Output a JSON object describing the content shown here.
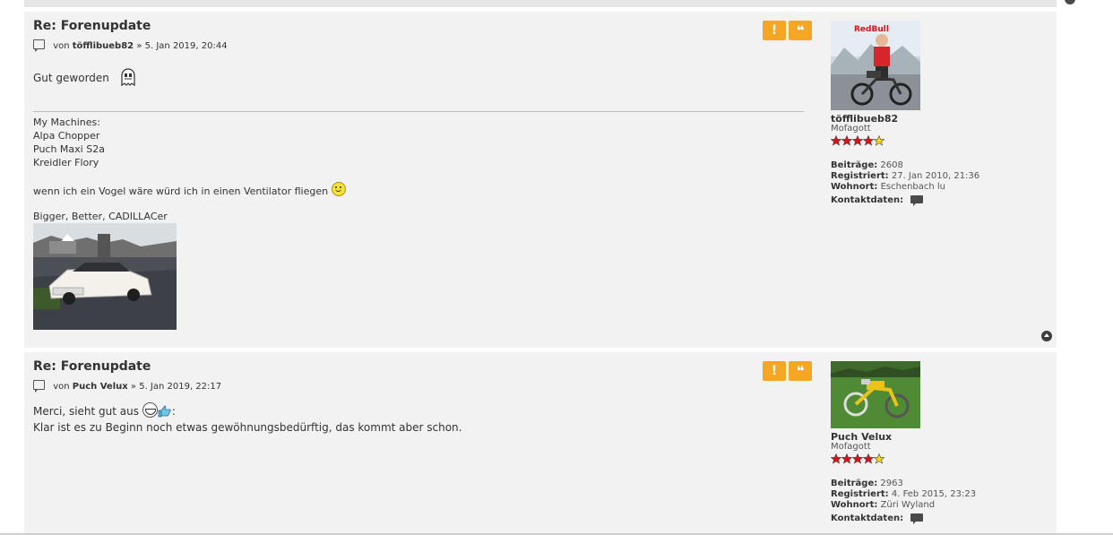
{
  "posts": [
    {
      "title": "Re: Forenupdate",
      "meta": {
        "prefix": "von",
        "author": "töfflibueb82",
        "sep": "»",
        "date": "5. Jan 2019, 20:44"
      },
      "content": [
        "Gut geworden"
      ],
      "signature": {
        "lines": [
          "My Machines:",
          "Alpa Chopper",
          "Puch Maxi S2a",
          "Kreidler Flory"
        ],
        "quote": "wenn ich ein Vogel wäre würd ich in einen Ventilator fliegen",
        "tagline": "Bigger, Better, CADILLACer"
      },
      "profile": {
        "username": "töfflibueb82",
        "rank": "Mofagott",
        "posts_label": "Beiträge:",
        "posts_value": "2608",
        "registered_label": "Registriert:",
        "registered_value": "27. Jan 2010, 21:36",
        "location_label": "Wohnort:",
        "location_value": "Eschenbach lu",
        "contact_label": "Kontaktdaten:"
      }
    },
    {
      "title": "Re: Forenupdate",
      "meta": {
        "prefix": "von",
        "author": "Puch Velux",
        "sep": "»",
        "date": "5. Jan 2019, 22:17"
      },
      "content": [
        "Merci, sieht gut aus",
        ":",
        "Klar ist es zu Beginn noch etwas gewöhnungsbedürftig, das kommt aber schon."
      ],
      "profile": {
        "username": "Puch Velux",
        "rank": "Mofagott",
        "posts_label": "Beiträge:",
        "posts_value": "2963",
        "registered_label": "Registriert:",
        "registered_value": "4. Feb 2015, 23:23",
        "location_label": "Wohnort:",
        "location_value": "Züri Wyland",
        "contact_label": "Kontaktdaten:"
      }
    }
  ],
  "buttons": {
    "report": "!",
    "quote": "❝"
  },
  "icons": [
    "post-icon",
    "ghost-icon",
    "smiley-icon",
    "grin-icon",
    "thumbs-up-icon",
    "star-icon",
    "contact-icon",
    "back-to-top-icon"
  ],
  "colors": {
    "accent": "#f5a623",
    "panel": "#f2f2f2",
    "star_red": "#d7141a",
    "star_yellow": "#f4d31f"
  },
  "rank_stars": {
    "filled": 4,
    "of": 5
  }
}
